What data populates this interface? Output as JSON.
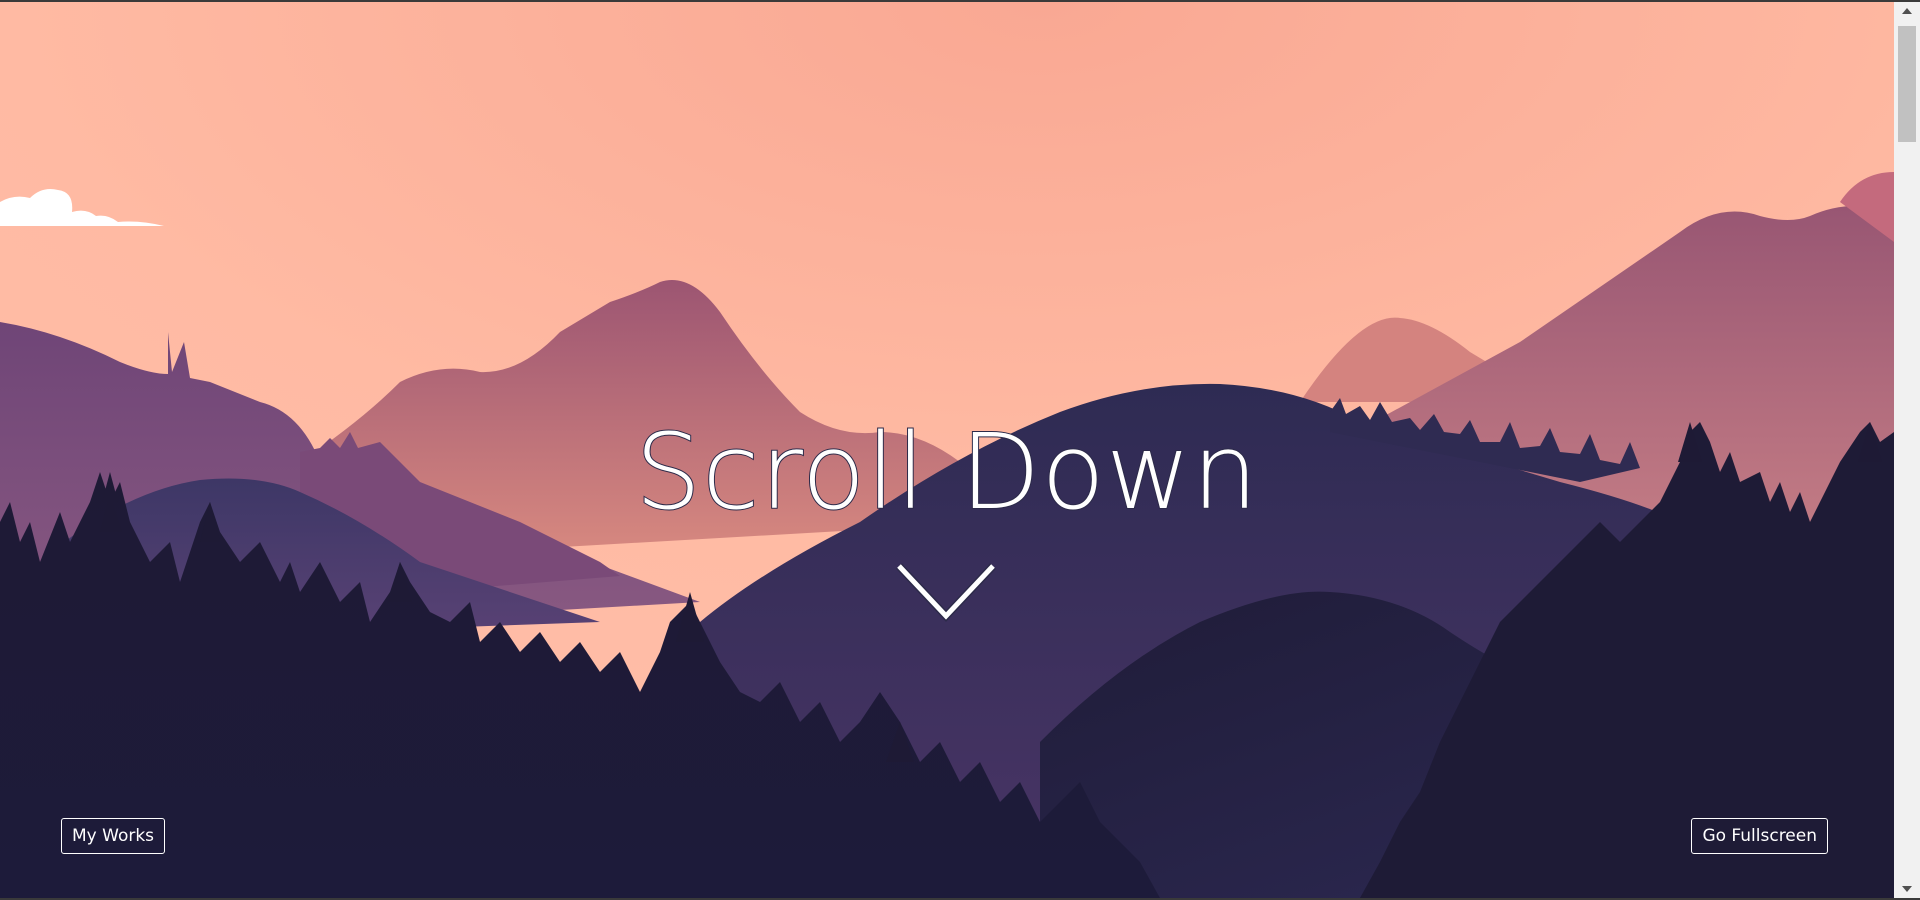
{
  "hero": {
    "title": "Scroll Down",
    "scroll_hint_icon": "chevron-down-icon"
  },
  "buttons": {
    "my_works": "My Works",
    "fullscreen": "Go Fullscreen"
  },
  "scene": {
    "description_icons": [
      "cloud-icon",
      "mountain-range",
      "pine-forest"
    ],
    "colors": {
      "sky_top": "#fbab96",
      "sky_bottom": "#ffbda6",
      "far_mountain": "#a45d78",
      "mid_mountain": "#7c4c78",
      "near_hill": "#2f2c52",
      "forest": "#1d1a33",
      "cloud": "#ffffff"
    }
  },
  "scrollbar": {
    "up_icon": "scroll-up-arrow-icon",
    "down_icon": "scroll-down-arrow-icon"
  }
}
